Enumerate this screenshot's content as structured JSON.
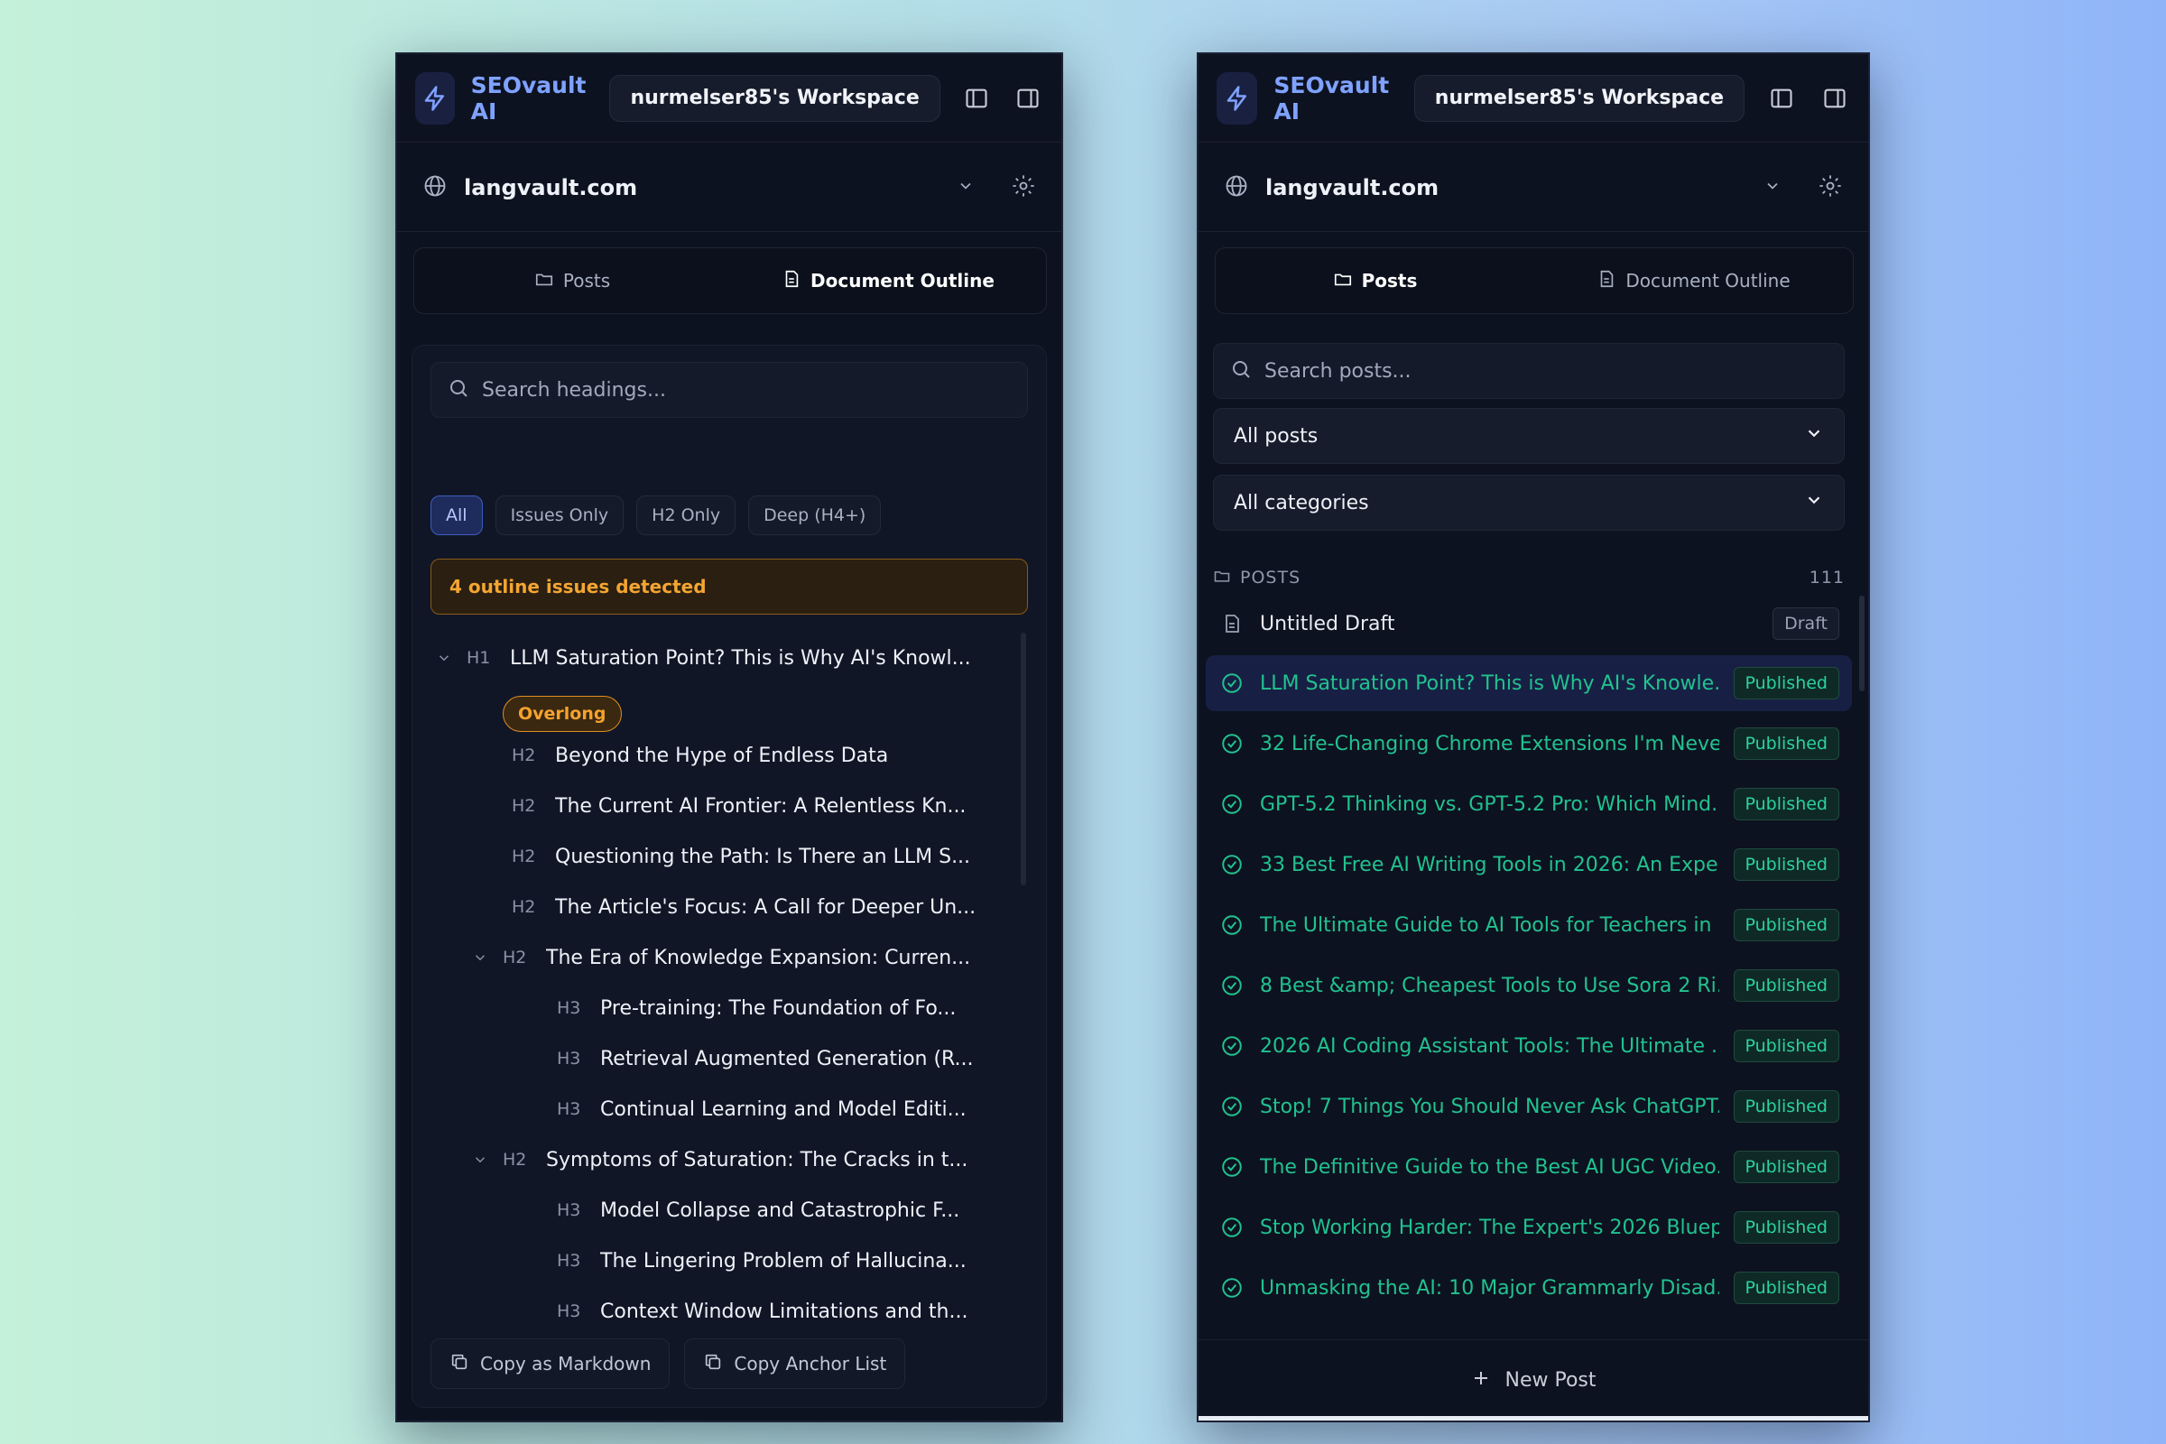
{
  "app": {
    "brand": "SEOvault AI",
    "workspace": "nurmelser85's Workspace",
    "site": "langvault.com"
  },
  "tabs": {
    "posts": "Posts",
    "outline": "Document Outline"
  },
  "outline": {
    "search_placeholder": "Search headings...",
    "filters": [
      "All",
      "Issues Only",
      "H2 Only",
      "Deep (H4+)"
    ],
    "issues_text": "4 outline issues detected",
    "overlong_badge": "Overlong",
    "headings": [
      {
        "level": "H1",
        "text": "LLM Saturation Point? This is Why AI's Knowl..."
      },
      {
        "level": "H2",
        "text": "Beyond the Hype of Endless Data"
      },
      {
        "level": "H2",
        "text": "The Current AI Frontier: A Relentless Kn..."
      },
      {
        "level": "H2",
        "text": "Questioning the Path: Is There an LLM S..."
      },
      {
        "level": "H2",
        "text": "The Article's Focus: A Call for Deeper Un..."
      },
      {
        "level": "H2",
        "text": "The Era of Knowledge Expansion: Curren..."
      },
      {
        "level": "H3",
        "text": "Pre-training: The Foundation of Fo..."
      },
      {
        "level": "H3",
        "text": "Retrieval Augmented Generation (R..."
      },
      {
        "level": "H3",
        "text": "Continual Learning and Model Editi..."
      },
      {
        "level": "H2",
        "text": "Symptoms of Saturation: The Cracks in t..."
      },
      {
        "level": "H3",
        "text": "Model Collapse and Catastrophic F..."
      },
      {
        "level": "H3",
        "text": "The Lingering Problem of Hallucina..."
      },
      {
        "level": "H3",
        "text": "Context Window Limitations and th..."
      }
    ],
    "copy_markdown": "Copy as Markdown",
    "copy_anchor": "Copy Anchor List"
  },
  "posts": {
    "search_placeholder": "Search posts...",
    "status_filter": "All posts",
    "category_filter": "All categories",
    "section_label": "POSTS",
    "count": "111",
    "items": [
      {
        "title": "Untitled Draft",
        "status": "Draft"
      },
      {
        "title": "LLM Saturation Point? This is Why AI's Knowle...",
        "status": "Published"
      },
      {
        "title": "32 Life-Changing Chrome Extensions I'm Neve...",
        "status": "Published"
      },
      {
        "title": "GPT-5.2 Thinking vs. GPT-5.2 Pro: Which Mind...",
        "status": "Published"
      },
      {
        "title": "33 Best Free AI Writing Tools in 2026: An Expe...",
        "status": "Published"
      },
      {
        "title": "The Ultimate Guide to AI Tools for Teachers in ...",
        "status": "Published"
      },
      {
        "title": "8 Best &amp; Cheapest Tools to Use Sora 2 Ri...",
        "status": "Published"
      },
      {
        "title": "2026 AI Coding Assistant Tools: The Ultimate ...",
        "status": "Published"
      },
      {
        "title": "Stop! 7 Things You Should Never Ask ChatGPT...",
        "status": "Published"
      },
      {
        "title": "The Definitive Guide to the Best AI UGC Video...",
        "status": "Published"
      },
      {
        "title": "Stop Working Harder: The Expert's 2026 Bluep...",
        "status": "Published"
      },
      {
        "title": "Unmasking the AI: 10 Major Grammarly Disad...",
        "status": "Published"
      }
    ],
    "new_post": "New Post"
  },
  "colors": {
    "accent": "#7fa2ff",
    "published": "#21c28f",
    "warning": "#f4a531",
    "panel_bg": "#0d1220"
  },
  "icons": [
    "bolt-icon",
    "sidebar-left-icon",
    "sidebar-right-icon",
    "globe-icon",
    "chevron-down-icon",
    "gear-icon",
    "folder-icon",
    "document-icon",
    "search-icon",
    "check-circle-icon",
    "copy-icon",
    "plus-icon"
  ]
}
